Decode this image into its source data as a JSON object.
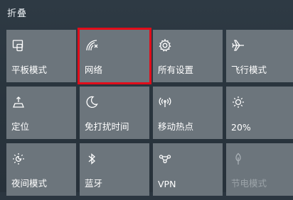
{
  "panel": {
    "collapse_label": "折叠"
  },
  "tiles": [
    {
      "label": "平板模式",
      "icon": "tablet-mode-icon"
    },
    {
      "label": "网络",
      "icon": "network-icon"
    },
    {
      "label": "所有设置",
      "icon": "gear-icon"
    },
    {
      "label": "飞行模式",
      "icon": "airplane-icon"
    },
    {
      "label": "定位",
      "icon": "location-icon"
    },
    {
      "label": "免打扰时间",
      "icon": "moon-icon"
    },
    {
      "label": "移动热点",
      "icon": "hotspot-icon"
    },
    {
      "label": "20%",
      "icon": "brightness-icon"
    },
    {
      "label": "夜间模式",
      "icon": "night-light-icon"
    },
    {
      "label": "蓝牙",
      "icon": "bluetooth-icon"
    },
    {
      "label": "VPN",
      "icon": "vpn-icon"
    },
    {
      "label": "节电模式",
      "icon": "battery-saver-icon"
    }
  ],
  "colors": {
    "tile_bg": "#6c757c",
    "highlight_border": "#e10d1a"
  }
}
